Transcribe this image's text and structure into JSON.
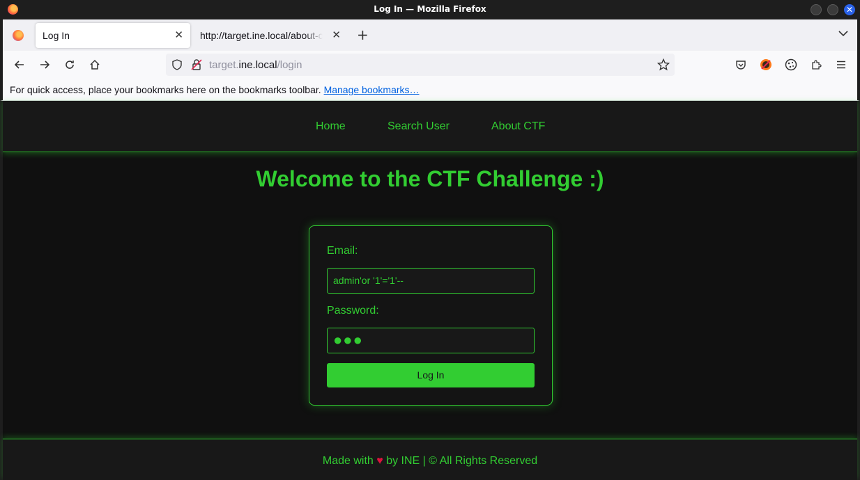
{
  "window": {
    "title": "Log In — Mozilla Firefox"
  },
  "tabs": [
    {
      "label": "Log In",
      "active": true
    },
    {
      "label": "http://target.ine.local/about-ctf",
      "active": false
    }
  ],
  "urlbar": {
    "url_prefix": "target.",
    "url_host": "ine.local",
    "url_path": "/login"
  },
  "bookmarks_bar": {
    "message": "For quick access, place your bookmarks here on the bookmarks toolbar.",
    "link": "Manage bookmarks…"
  },
  "site_nav": {
    "items": [
      "Home",
      "Search User",
      "About CTF"
    ]
  },
  "page": {
    "heading": "Welcome to the CTF Challenge :)"
  },
  "login_form": {
    "email_label": "Email:",
    "email_value": "admin'or '1'='1'--",
    "password_label": "Password:",
    "password_mask": "●●●",
    "submit_label": "Log In"
  },
  "footer": {
    "text_before": "Made with",
    "heart": "♥",
    "text_after": "by INE | © All Rights Reserved"
  },
  "colors": {
    "accent": "#32cd32",
    "heart": "#dc143c",
    "page_bg": "#101010"
  }
}
